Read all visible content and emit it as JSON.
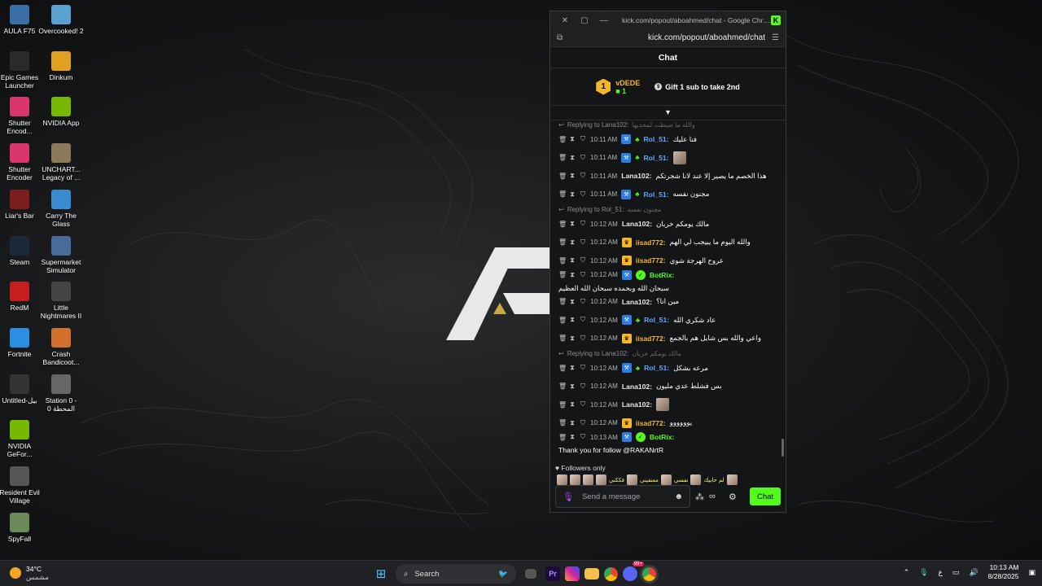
{
  "desktop": {
    "icons_col1": [
      {
        "label": "AULA F75",
        "icon": "keyboard-icon",
        "color": "#3b6ea5"
      },
      {
        "label": "Epic Games Launcher",
        "icon": "epic-icon",
        "color": "#2a2a2a"
      },
      {
        "label": "Shutter Encod...",
        "icon": "shutter-icon",
        "color": "#d9366e"
      },
      {
        "label": "Shutter Encoder",
        "icon": "shutter-icon",
        "color": "#d9366e"
      },
      {
        "label": "Liar's Bar",
        "icon": "game-icon",
        "color": "#7a1e1e"
      },
      {
        "label": "Steam",
        "icon": "steam-icon",
        "color": "#1b2838"
      },
      {
        "label": "RedM",
        "icon": "redm-icon",
        "color": "#c41e1e"
      },
      {
        "label": "Fortnite",
        "icon": "fortnite-icon",
        "color": "#2b8ee0"
      },
      {
        "label": "Untitled-بيل",
        "icon": "file-icon",
        "color": "#333"
      },
      {
        "label": "NVIDIA GeFor...",
        "icon": "nvidia-icon",
        "color": "#76b900"
      },
      {
        "label": "Resident Evil Village",
        "icon": "game-icon",
        "color": "#555"
      },
      {
        "label": "SpyFall",
        "icon": "game-icon",
        "color": "#6a8a5a"
      }
    ],
    "icons_col2": [
      {
        "label": "Overcooked! 2",
        "icon": "game-icon",
        "color": "#5aa0d0"
      },
      {
        "label": "Dinkum",
        "icon": "dinkum-icon",
        "color": "#e0a020"
      },
      {
        "label": "NVIDIA App",
        "icon": "nvidia-icon",
        "color": "#76b900"
      },
      {
        "label": "UNCHART... Legacy of ...",
        "icon": "game-icon",
        "color": "#8a7a5a"
      },
      {
        "label": "Carry The Glass",
        "icon": "game-icon",
        "color": "#3a8ad0"
      },
      {
        "label": "Supermarket Simulator",
        "icon": "game-icon",
        "color": "#4a6a9a"
      },
      {
        "label": "Little Nightmares II",
        "icon": "game-icon",
        "color": "#444"
      },
      {
        "label": "Crash Bandicoot...",
        "icon": "game-icon",
        "color": "#d0702a"
      },
      {
        "label": "Station 0 - المحطة 0",
        "icon": "game-icon",
        "color": "#666"
      }
    ]
  },
  "window": {
    "title": "kick.com/popout/aboahmed/chat - Google Chro...",
    "url": "kick.com/popout/aboahmed/chat"
  },
  "chat": {
    "header": "Chat",
    "leader": {
      "rank": "1",
      "name": "vDEDE",
      "count": "1"
    },
    "gift_text": "Gift 1 sub to take 2nd",
    "messages": [
      {
        "reply_to": "Replying to Lana102:",
        "reply_text": "والله ما ضبطت لمحديها",
        "time": "10:11 AM",
        "badges": [
          "blue",
          "gift"
        ],
        "user": "Rol_51:",
        "user_color": "#5fa8ff",
        "text": "فنا عليك"
      },
      {
        "reply_to": "",
        "reply_text": "",
        "time": "10:11 AM",
        "badges": [
          "blue",
          "gift"
        ],
        "user": "Rol_51:",
        "user_color": "#5fa8ff",
        "text": "",
        "emote": true
      },
      {
        "reply_to": "",
        "reply_text": "",
        "time": "10:11 AM",
        "badges": [],
        "user": "Lana102:",
        "user_color": "#e8e8e8",
        "text": "هذا الخصم ما يصير إلا عند لانا شجرتكم"
      },
      {
        "reply_to": "",
        "reply_text": "",
        "time": "10:11 AM",
        "badges": [
          "blue",
          "gift"
        ],
        "user": "Rol_51:",
        "user_color": "#5fa8ff",
        "text": "مجنون نفسه"
      },
      {
        "reply_to": "Replying to Rol_51:",
        "reply_text": "مجنون نفسه",
        "time": "10:12 AM",
        "badges": [],
        "user": "Lana102:",
        "user_color": "#e8e8e8",
        "text": "مالك يومكم خربان"
      },
      {
        "reply_to": "",
        "reply_text": "",
        "time": "10:12 AM",
        "badges": [
          "gold"
        ],
        "user": "iisad772:",
        "user_color": "#f3b52a",
        "text": "والله اليوم ما يبيجب لي الهم"
      },
      {
        "reply_to": "",
        "reply_text": "",
        "time": "10:12 AM",
        "badges": [
          "gold"
        ],
        "user": "iisad772:",
        "user_color": "#f3b52a",
        "text": "عروح الهرجة شوي"
      },
      {
        "reply_to": "",
        "reply_text": "",
        "time": "10:12 AM",
        "badges": [
          "blue",
          "green"
        ],
        "user": "BotRix:",
        "user_color": "#53fc18",
        "text": "سبحان الله وبحمده سبحان الله العظيم"
      },
      {
        "reply_to": "",
        "reply_text": "",
        "time": "10:12 AM",
        "badges": [],
        "user": "Lana102:",
        "user_color": "#e8e8e8",
        "text": "مين انا؟"
      },
      {
        "reply_to": "",
        "reply_text": "",
        "time": "10:12 AM",
        "badges": [
          "blue",
          "gift"
        ],
        "user": "Rol_51:",
        "user_color": "#5fa8ff",
        "text": "عاد شكري الله"
      },
      {
        "reply_to": "",
        "reply_text": "",
        "time": "10:12 AM",
        "badges": [
          "gold"
        ],
        "user": "iisad772:",
        "user_color": "#f3b52a",
        "text": "واعي والله بس شايل هم بالجمع"
      },
      {
        "reply_to": "Replying to Lana102:",
        "reply_text": "مالك يومكم خربان",
        "time": "10:12 AM",
        "badges": [
          "blue",
          "gift"
        ],
        "user": "Rol_51:",
        "user_color": "#5fa8ff",
        "text": "مرعه بشكل"
      },
      {
        "reply_to": "",
        "reply_text": "",
        "time": "10:12 AM",
        "badges": [],
        "user": "Lana102:",
        "user_color": "#e8e8e8",
        "text": "بس فشلط عدي مليون"
      },
      {
        "reply_to": "",
        "reply_text": "",
        "time": "10:12 AM",
        "badges": [],
        "user": "Lana102:",
        "user_color": "#e8e8e8",
        "text": "",
        "emote": true
      },
      {
        "reply_to": "",
        "reply_text": "",
        "time": "10:12 AM",
        "badges": [
          "gold"
        ],
        "user": "iisad772:",
        "user_color": "#f3b52a",
        "text": "يوووووو"
      },
      {
        "reply_to": "",
        "reply_text": "",
        "time": "10:13 AM",
        "badges": [
          "blue",
          "green"
        ],
        "user": "BotRix:",
        "user_color": "#53fc18",
        "text": "Thank you for follow @RAKANrtR"
      }
    ],
    "followers_only": "Followers only",
    "emote_row_text": [
      "فككني",
      "معنفيني",
      "نفسي",
      "لم حابيك"
    ],
    "input_placeholder": "Send a message",
    "send_label": "Chat"
  },
  "taskbar": {
    "temp": "34°C",
    "weather": "مشمس",
    "search": "Search",
    "lang": "ع",
    "time": "10:13 AM",
    "date": "8/28/2025",
    "discord_badge": "99+"
  }
}
